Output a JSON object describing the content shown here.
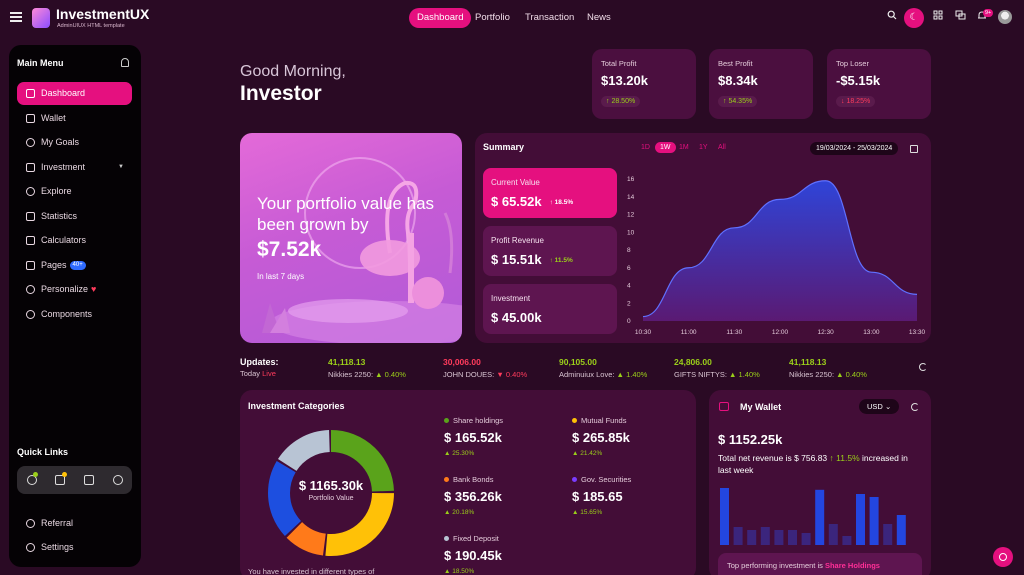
{
  "brand": {
    "title": "InvestmentUX",
    "subtitle": "AdminUIUX HTML template"
  },
  "nav": [
    {
      "label": "Dashboard",
      "active": true
    },
    {
      "label": "Portfolio"
    },
    {
      "label": "Transaction"
    },
    {
      "label": "News"
    }
  ],
  "topbar": {
    "notification_badge": "9+",
    "icons": [
      "search-icon",
      "moon-icon",
      "apps-icon",
      "chat-icon",
      "bell-icon"
    ]
  },
  "sidebar": {
    "title": "Main Menu",
    "items": [
      {
        "label": "Dashboard",
        "active": true
      },
      {
        "label": "Wallet"
      },
      {
        "label": "My Goals"
      },
      {
        "label": "Investment"
      },
      {
        "label": "Explore"
      },
      {
        "label": "Statistics"
      },
      {
        "label": "Calculators"
      },
      {
        "label": "Pages",
        "badge": "40+"
      },
      {
        "label": "Personalize"
      },
      {
        "label": "Components"
      }
    ],
    "quick_links_title": "Quick Links",
    "bottom_items": [
      {
        "label": "Referral"
      },
      {
        "label": "Settings"
      }
    ]
  },
  "greeting": {
    "line1": "Good Morning,",
    "line2": "Investor"
  },
  "stats": [
    {
      "label": "Total Profit",
      "value": "$13.20k",
      "change": "28.50%",
      "direction": "up"
    },
    {
      "label": "Best Profit",
      "value": "$8.34k",
      "change": "54.35%",
      "direction": "up"
    },
    {
      "label": "Top Loser",
      "value": "-$5.15k",
      "change": "18.25%",
      "direction": "down"
    }
  ],
  "portfolio": {
    "text": "Your portfolio value has been grown by",
    "amount": "$7.52k",
    "sub": "In last 7 days"
  },
  "summary": {
    "title": "Summary",
    "ranges": [
      "1D",
      "1W",
      "1M",
      "1Y",
      "All"
    ],
    "active_range": "1W",
    "date_range": "19/03/2024 - 25/03/2024",
    "metrics": [
      {
        "label": "Current Value",
        "value": "$ 65.52k",
        "change": "18.5%",
        "active": true
      },
      {
        "label": "Profit Revenue",
        "value": "$ 15.51k",
        "change": "11.5%"
      },
      {
        "label": "Investment",
        "value": "$ 45.00k",
        "change": ""
      }
    ]
  },
  "chart_data": {
    "type": "area",
    "title": "",
    "xlabel": "",
    "ylabel": "",
    "x": [
      "10:30",
      "11:00",
      "11:30",
      "12:00",
      "12:30",
      "13:00",
      "13:30"
    ],
    "y_ticks": [
      0,
      2,
      4,
      6,
      8,
      10,
      12,
      14,
      16
    ],
    "ylim": [
      0,
      16
    ],
    "series": [
      {
        "values": [
          0.5,
          6,
          10.5,
          13.7,
          15.8,
          5.5,
          3.0
        ]
      }
    ],
    "grid": false
  },
  "updates": {
    "title": "Updates:",
    "sub": "Today",
    "live": "Live",
    "items": [
      {
        "value": "41,118.13",
        "name": "Nikkies 2250:",
        "change": "0.40%",
        "direction": "up"
      },
      {
        "value": "30,006.00",
        "name": "JOHN DOUES:",
        "change": "0.40%",
        "direction": "down"
      },
      {
        "value": "90,105.00",
        "name": "Adminuiux Love:",
        "change": "1.40%",
        "direction": "up"
      },
      {
        "value": "24,806.00",
        "name": "GIFTS NIFTYS:",
        "change": "1.40%",
        "direction": "up"
      },
      {
        "value": "41,118.13",
        "name": "Nikkies 2250:",
        "change": "0.40%",
        "direction": "up"
      }
    ]
  },
  "investment_categories": {
    "title": "Investment Categories",
    "total": "$ 1165.30k",
    "total_label": "Portfolio Value",
    "footer": "You have invested in different types of",
    "categories": [
      {
        "label": "Share holdings",
        "value": "$ 165.52k",
        "change": "25.30%",
        "color": "#5aa31b"
      },
      {
        "label": "Mutual Funds",
        "value": "$ 265.85k",
        "change": "21.42%",
        "color": "#ffc107"
      },
      {
        "label": "Bank Bonds",
        "value": "$ 356.26k",
        "change": "20.18%",
        "color": "#ff7a1a"
      },
      {
        "label": "Gov. Securities",
        "value": "$ 185.65",
        "change": "15.65%",
        "color": "#7a3cff"
      },
      {
        "label": "Fixed Deposit",
        "value": "$ 190.45k",
        "change": "18.50%",
        "color": "#b8c4d4"
      }
    ],
    "donut": [
      {
        "name": "green",
        "value": 25,
        "color": "#5aa31b"
      },
      {
        "name": "yellow",
        "value": 27,
        "color": "#ffc107"
      },
      {
        "name": "orange",
        "value": 11,
        "color": "#ff7a1a"
      },
      {
        "name": "blue",
        "value": 21,
        "color": "#1d4fe0"
      },
      {
        "name": "grey",
        "value": 16,
        "color": "#b8c4d4"
      }
    ]
  },
  "wallet": {
    "title": "My Wallet",
    "currency": "USD",
    "amount": "$ 1152.25k",
    "desc_prefix": "Total net revenue is $ 756.83",
    "desc_change": "11.5%",
    "desc_suffix": "increased in last week",
    "bars": [
      {
        "v": 0.95,
        "hi": true
      },
      {
        "v": 0.3
      },
      {
        "v": 0.25
      },
      {
        "v": 0.3
      },
      {
        "v": 0.25
      },
      {
        "v": 0.25
      },
      {
        "v": 0.2
      },
      {
        "v": 0.92,
        "hi": true
      },
      {
        "v": 0.35
      },
      {
        "v": 0.15
      },
      {
        "v": 0.85,
        "hi": true
      },
      {
        "v": 0.8,
        "hi": true
      },
      {
        "v": 0.35
      },
      {
        "v": 0.5,
        "hi": true
      }
    ],
    "footer_prefix": "Top performing investment is",
    "footer_highlight": "Share Holdings"
  }
}
